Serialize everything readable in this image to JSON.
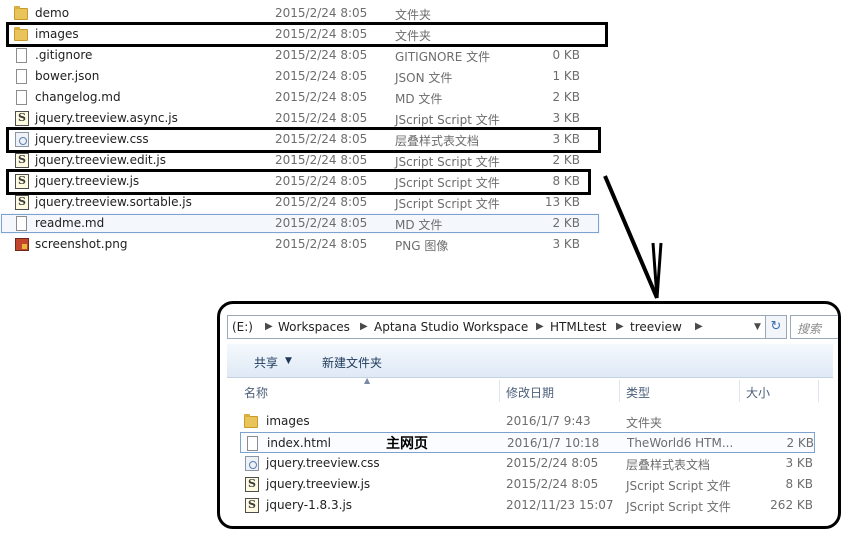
{
  "top_files": [
    {
      "name": "demo",
      "date": "2015/2/24 8:05",
      "type": "文件夹",
      "size": "",
      "icon": "folder-icon"
    },
    {
      "name": "images",
      "date": "2015/2/24 8:05",
      "type": "文件夹",
      "size": "",
      "icon": "folder-icon"
    },
    {
      "name": ".gitignore",
      "date": "2015/2/24 8:05",
      "type": "GITIGNORE 文件",
      "size": "0 KB",
      "icon": "document-icon"
    },
    {
      "name": "bower.json",
      "date": "2015/2/24 8:05",
      "type": "JSON 文件",
      "size": "1 KB",
      "icon": "document-icon"
    },
    {
      "name": "changelog.md",
      "date": "2015/2/24 8:05",
      "type": "MD 文件",
      "size": "2 KB",
      "icon": "document-icon"
    },
    {
      "name": "jquery.treeview.async.js",
      "date": "2015/2/24 8:05",
      "type": "JScript Script 文件",
      "size": "3 KB",
      "icon": "script-icon"
    },
    {
      "name": "jquery.treeview.css",
      "date": "2015/2/24 8:05",
      "type": "层叠样式表文档",
      "size": "3 KB",
      "icon": "stylesheet-icon"
    },
    {
      "name": "jquery.treeview.edit.js",
      "date": "2015/2/24 8:05",
      "type": "JScript Script 文件",
      "size": "2 KB",
      "icon": "script-icon"
    },
    {
      "name": "jquery.treeview.js",
      "date": "2015/2/24 8:05",
      "type": "JScript Script 文件",
      "size": "8 KB",
      "icon": "script-icon"
    },
    {
      "name": "jquery.treeview.sortable.js",
      "date": "2015/2/24 8:05",
      "type": "JScript Script 文件",
      "size": "13 KB",
      "icon": "script-icon"
    },
    {
      "name": "readme.md",
      "date": "2015/2/24 8:05",
      "type": "MD 文件",
      "size": "2 KB",
      "icon": "document-icon"
    },
    {
      "name": "screenshot.png",
      "date": "2015/2/24 8:05",
      "type": "PNG 图像",
      "size": "3 KB",
      "icon": "image-icon"
    }
  ],
  "explorer": {
    "address": {
      "drive": "(E:)",
      "crumbs": [
        "Workspaces",
        "Aptana Studio Workspace",
        "HTMLtest",
        "treeview"
      ],
      "search_placeholder": "搜索"
    },
    "toolbar": {
      "share": "共享",
      "new_folder": "新建文件夹"
    },
    "columns": {
      "name": "名称",
      "date": "修改日期",
      "type": "类型",
      "size": "大小"
    },
    "files": [
      {
        "name": "images",
        "date": "2016/1/7 9:43",
        "type": "文件夹",
        "size": "",
        "icon": "folder-icon"
      },
      {
        "name": "index.html",
        "date": "2016/1/7 10:18",
        "type": "TheWorld6 HTM...",
        "size": "2 KB",
        "icon": "document-icon"
      },
      {
        "name": "jquery.treeview.css",
        "date": "2015/2/24 8:05",
        "type": "层叠样式表文档",
        "size": "3 KB",
        "icon": "stylesheet-icon"
      },
      {
        "name": "jquery.treeview.js",
        "date": "2015/2/24 8:05",
        "type": "JScript Script 文件",
        "size": "8 KB",
        "icon": "script-icon"
      },
      {
        "name": "jquery-1.8.3.js",
        "date": "2012/11/23 15:07",
        "type": "JScript Script 文件",
        "size": "262 KB",
        "icon": "script-icon"
      }
    ],
    "annotation": "主网页"
  }
}
